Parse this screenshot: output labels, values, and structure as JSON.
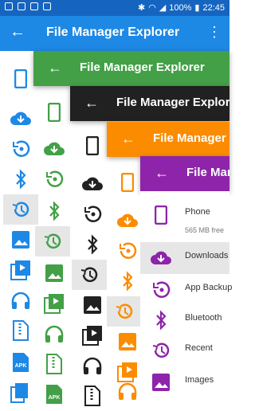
{
  "status_bar": {
    "battery": "100%",
    "time": "22:45"
  },
  "main_toolbar": {
    "title": "File Manager Explorer"
  },
  "panels": [
    {
      "title": "File Manager Explorer",
      "color": "#43a047"
    },
    {
      "title": "File Manager Explorer",
      "color": "#212121"
    },
    {
      "title": "File Manager",
      "color": "#fb8c00"
    },
    {
      "title": "File Manager",
      "color": "#8e24aa"
    }
  ],
  "accent_colors": {
    "blue": "#1e88e5",
    "green": "#43a047",
    "black": "#212121",
    "orange": "#fb8c00",
    "purple": "#8e24aa"
  },
  "purple_list": [
    {
      "label": "Phone",
      "sub": "565 MB free",
      "icon": "phone-icon"
    },
    {
      "label": "Downloads",
      "icon": "download-cloud-icon"
    },
    {
      "label": "App Backup",
      "icon": "backup-icon"
    },
    {
      "label": "Bluetooth",
      "icon": "bluetooth-icon"
    },
    {
      "label": "Recent",
      "icon": "recent-icon"
    },
    {
      "label": "Images",
      "icon": "image-icon"
    }
  ],
  "apk_label": "APK"
}
